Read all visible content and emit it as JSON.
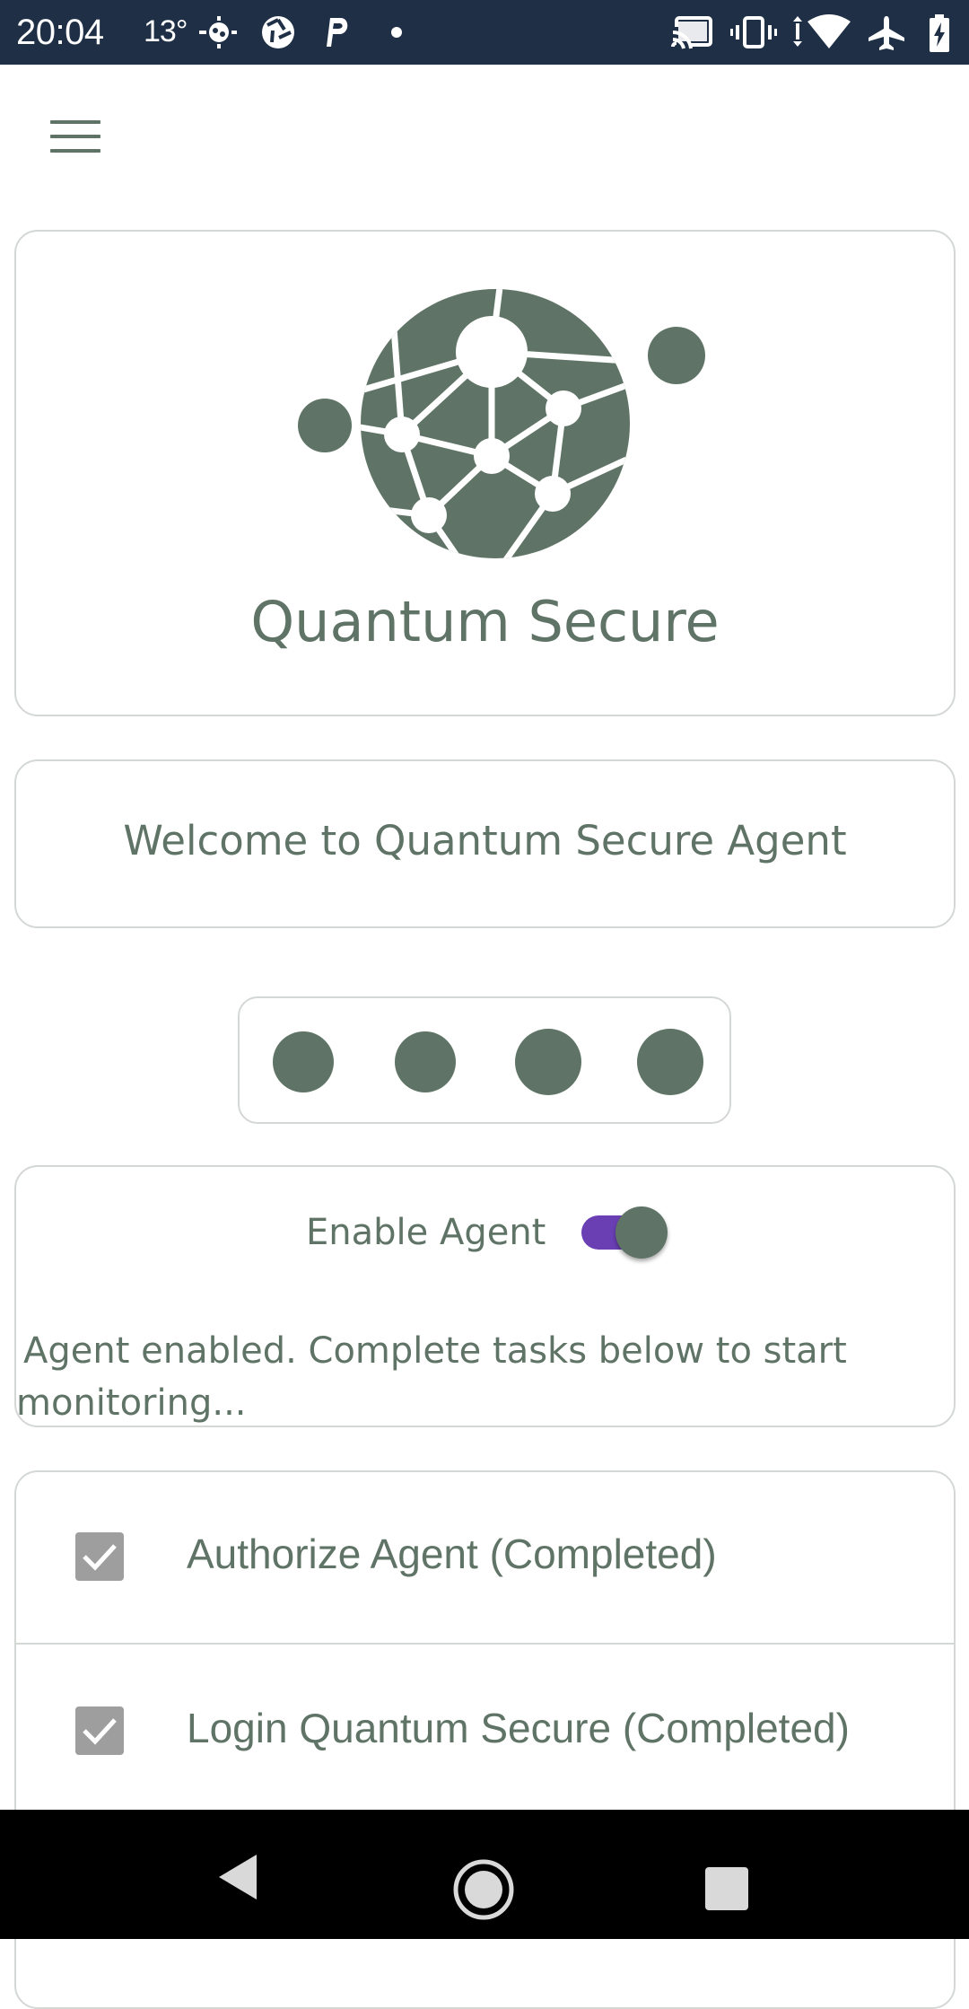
{
  "status_bar": {
    "time": "20:04",
    "temperature": "13°",
    "icons": [
      "weather-icon",
      "aperture-icon",
      "parking-icon",
      "notification-dot",
      "cast-icon",
      "vibrate-icon",
      "wifi-data-icon",
      "airplane-mode-icon",
      "battery-charging-icon"
    ]
  },
  "app_bar": {
    "menu_icon": "hamburger-menu-icon"
  },
  "logo": {
    "icon": "network-globe-logo",
    "app_name": "Quantum Secure"
  },
  "welcome": {
    "text": "Welcome to Quantum Secure Agent"
  },
  "pin_indicator": {
    "count": 4,
    "filled": 4
  },
  "agent": {
    "enable_label": "Enable Agent",
    "enabled": true,
    "status_text": "Agent enabled. Complete tasks below to start monitoring..."
  },
  "tasks": [
    {
      "label": "Authorize Agent (Completed)",
      "checked": true
    },
    {
      "label": "Login Quantum Secure (Completed)",
      "checked": true
    }
  ],
  "nav_bar": {
    "buttons": [
      "back-icon",
      "home-icon",
      "recents-icon"
    ]
  },
  "colors": {
    "primary": "#5f7466",
    "toggle_track": "#6a3fb4",
    "status_bar": "#1f3046",
    "card_border": "#d4d8d5",
    "checkbox": "#9e9e9e"
  }
}
